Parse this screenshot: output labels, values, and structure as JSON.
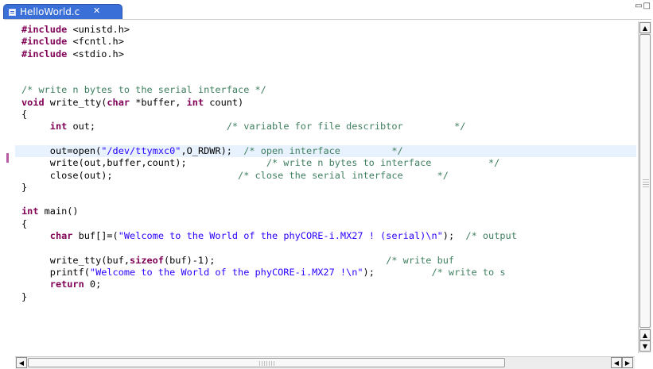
{
  "tab": {
    "filename": "HelloWorld.c",
    "close_glyph": "✕",
    "file_icon": "c-source-file-icon"
  },
  "window_controls": {
    "minimize": "▭",
    "maximize": "□",
    "icons": [
      "minimize-icon",
      "maximize-icon"
    ]
  },
  "scrollbars": {
    "up": "▲",
    "down": "▼",
    "left": "◀",
    "right": "▶"
  },
  "code": {
    "lines": [
      [
        {
          "t": "pp",
          "v": "#include"
        },
        {
          "t": "n",
          "v": " <unistd.h>"
        }
      ],
      [
        {
          "t": "pp",
          "v": "#include"
        },
        {
          "t": "n",
          "v": " <fcntl.h>"
        }
      ],
      [
        {
          "t": "pp",
          "v": "#include"
        },
        {
          "t": "n",
          "v": " <stdio.h>"
        }
      ],
      [],
      [],
      [
        {
          "t": "cmt",
          "v": "/* write n bytes to the serial interface */"
        }
      ],
      [
        {
          "t": "kw",
          "v": "void"
        },
        {
          "t": "n",
          "v": " write_tty("
        },
        {
          "t": "kw",
          "v": "char"
        },
        {
          "t": "n",
          "v": " *buffer, "
        },
        {
          "t": "kw",
          "v": "int"
        },
        {
          "t": "n",
          "v": " count)"
        }
      ],
      [
        {
          "t": "n",
          "v": "{"
        }
      ],
      [
        {
          "t": "n",
          "v": "     "
        },
        {
          "t": "kw",
          "v": "int"
        },
        {
          "t": "n",
          "v": " out;                       "
        },
        {
          "t": "cmt",
          "v": "/* variable for file describtor         */"
        }
      ],
      [],
      [
        {
          "t": "n",
          "v": "     out=open("
        },
        {
          "t": "str",
          "v": "\"/dev/ttymxc0\""
        },
        {
          "t": "n",
          "v": ",O_RDWR);  "
        },
        {
          "t": "cmt",
          "v": "/* open interface         */"
        }
      ],
      [
        {
          "t": "n",
          "v": "     write(out,buffer,count);              "
        },
        {
          "t": "cmt",
          "v": "/* write n bytes to interface          */"
        }
      ],
      [
        {
          "t": "n",
          "v": "     close(out);                      "
        },
        {
          "t": "cmt",
          "v": "/* close the serial interface      */"
        }
      ],
      [
        {
          "t": "n",
          "v": "}"
        }
      ],
      [],
      [
        {
          "t": "kw",
          "v": "int"
        },
        {
          "t": "n",
          "v": " main()"
        }
      ],
      [
        {
          "t": "n",
          "v": "{"
        }
      ],
      [
        {
          "t": "n",
          "v": "     "
        },
        {
          "t": "kw",
          "v": "char"
        },
        {
          "t": "n",
          "v": " buf[]=("
        },
        {
          "t": "str",
          "v": "\"Welcome to the World of the phyCORE-i.MX27 ! (serial)\\n\""
        },
        {
          "t": "n",
          "v": ");  "
        },
        {
          "t": "cmt",
          "v": "/* output"
        }
      ],
      [],
      [
        {
          "t": "n",
          "v": "     write_tty(buf,"
        },
        {
          "t": "kw",
          "v": "sizeof"
        },
        {
          "t": "n",
          "v": "(buf)-1);                              "
        },
        {
          "t": "cmt",
          "v": "/* write buf"
        }
      ],
      [
        {
          "t": "n",
          "v": "     printf("
        },
        {
          "t": "str",
          "v": "\"Welcome to the World of the phyCORE-i.MX27 !\\n\""
        },
        {
          "t": "n",
          "v": ");          "
        },
        {
          "t": "cmt",
          "v": "/* write to s"
        }
      ],
      [
        {
          "t": "n",
          "v": "     "
        },
        {
          "t": "kw",
          "v": "return"
        },
        {
          "t": "n",
          "v": " 0;"
        }
      ],
      [
        {
          "t": "n",
          "v": "}"
        }
      ]
    ],
    "highlighted_line": 10,
    "colors": {
      "keyword": "#7f0055",
      "string": "#2a00ff",
      "comment": "#3f7f5f",
      "current_line": "#e8f2fe",
      "tab_active": "#3a6fd8"
    }
  }
}
